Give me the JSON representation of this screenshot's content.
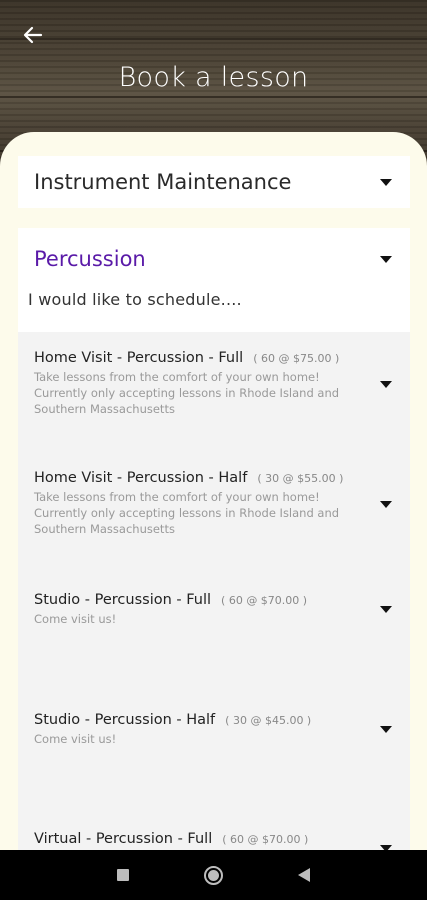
{
  "header": {
    "title": "Book a lesson",
    "back_icon": "arrow-left-icon"
  },
  "category_select": {
    "value": "Instrument Maintenance"
  },
  "instrument_select": {
    "value": "Percussion",
    "prompt": "I would like to schedule...."
  },
  "options": [
    {
      "title": "Home Visit - Percussion - Full",
      "price": "( 60 @ $75.00 )",
      "description": "Take lessons from the comfort of your own home! Currently only accepting lessons in Rhode Island and Southern Massachusetts"
    },
    {
      "title": "Home Visit - Percussion - Half",
      "price": "( 30 @ $55.00 )",
      "description": "Take lessons from the comfort of your own home! Currently only accepting lessons in Rhode Island and Southern Massachusetts"
    },
    {
      "title": "Studio - Percussion - Full",
      "price": "( 60 @ $70.00 )",
      "description": "Come visit us!"
    },
    {
      "title": "Studio - Percussion - Half",
      "price": "( 30 @ $45.00 )",
      "description": "Come visit us!"
    },
    {
      "title": "Virtual - Percussion - Full",
      "price": "( 60 @ $70.00 )",
      "description": ""
    }
  ],
  "colors": {
    "accent": "#5a1aa8",
    "sheet_bg": "#fdfbeb",
    "list_bg": "#f3f3f3"
  }
}
